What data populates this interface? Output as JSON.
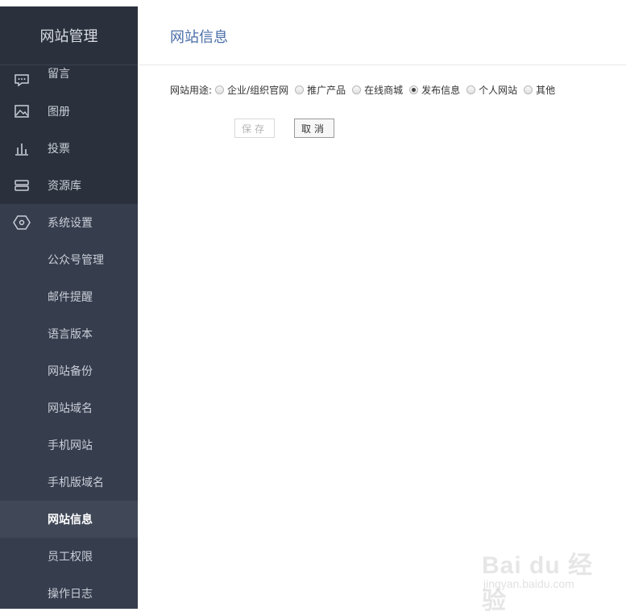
{
  "sidebar": {
    "title": "网站管理",
    "top_items": [
      {
        "label": "留言",
        "icon": "comment-icon"
      },
      {
        "label": "图册",
        "icon": "image-icon"
      },
      {
        "label": "投票",
        "icon": "bar-chart-icon"
      },
      {
        "label": "资源库",
        "icon": "database-icon"
      }
    ],
    "group": {
      "label": "系统设置",
      "icon": "settings-hexagon-icon"
    },
    "sub_items": [
      {
        "label": "公众号管理"
      },
      {
        "label": "邮件提醒"
      },
      {
        "label": "语言版本"
      },
      {
        "label": "网站备份"
      },
      {
        "label": "网站域名"
      },
      {
        "label": "手机网站"
      },
      {
        "label": "手机版域名"
      },
      {
        "label": "网站信息",
        "active": true
      },
      {
        "label": "员工权限"
      },
      {
        "label": "操作日志"
      }
    ]
  },
  "header": {
    "title": "网站信息"
  },
  "form": {
    "usage_label": "网站用途:",
    "options": [
      {
        "label": "企业/组织官网",
        "checked": false
      },
      {
        "label": "推广产品",
        "checked": false
      },
      {
        "label": "在线商城",
        "checked": false
      },
      {
        "label": "发布信息",
        "checked": true
      },
      {
        "label": "个人网站",
        "checked": false
      },
      {
        "label": "其他",
        "checked": false
      }
    ],
    "save_label": "保存",
    "cancel_label": "取消"
  },
  "watermark": {
    "main": "Bai du 经验",
    "sub": "jingyan.baidu.com"
  },
  "colors": {
    "sidebar_bg": "#2f3542",
    "title_blue": "#4b6fa8",
    "active_bg": "#404858"
  }
}
